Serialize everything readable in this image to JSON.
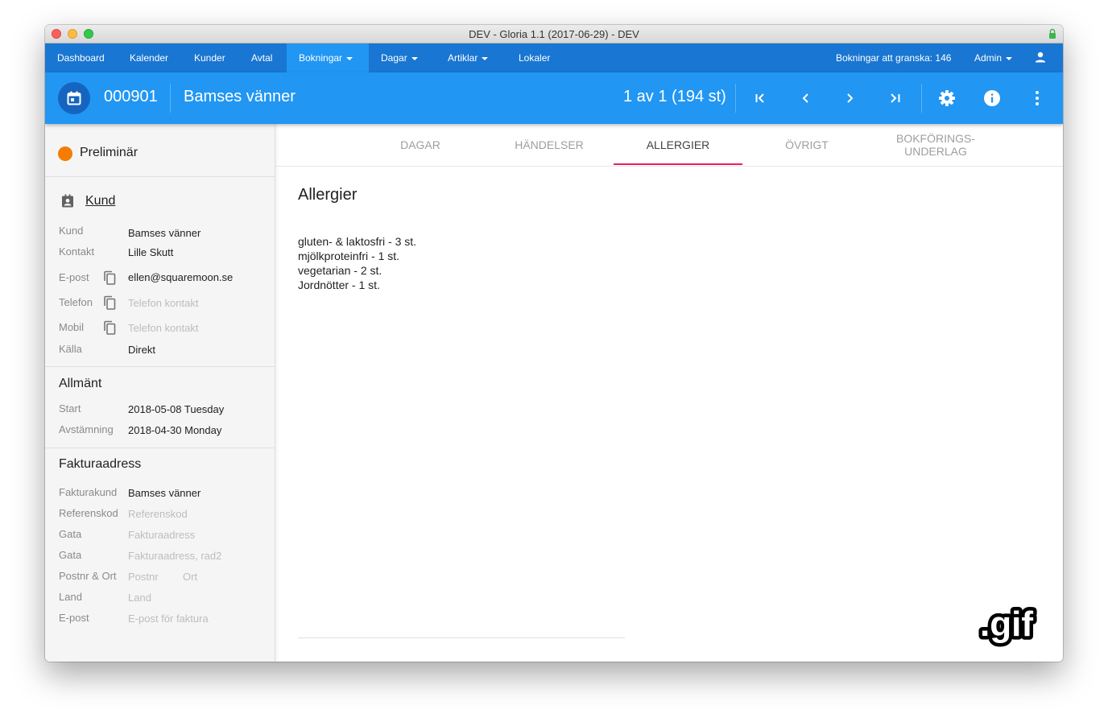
{
  "window": {
    "title": "DEV - Gloria 1.1 (2017-06-29) - DEV"
  },
  "nav": {
    "items": [
      {
        "label": "Dashboard"
      },
      {
        "label": "Kalender"
      },
      {
        "label": "Kunder"
      },
      {
        "label": "Avtal"
      },
      {
        "label": "Bokningar",
        "dropdown": true,
        "active": true
      },
      {
        "label": "Dagar",
        "dropdown": true
      },
      {
        "label": "Artiklar",
        "dropdown": true
      },
      {
        "label": "Lokaler"
      }
    ],
    "review": "Bokningar att granska: 146",
    "admin": "Admin"
  },
  "appbar": {
    "booking_number": "000901",
    "booking_name": "Bamses vänner",
    "counter": "1 av 1 (194 st)"
  },
  "sidebar": {
    "status": {
      "label": "Preliminär",
      "color": "#f57c00"
    },
    "customer_section": "Kund",
    "customer": [
      {
        "label": "Kund",
        "value": "Bamses vänner"
      },
      {
        "label": "Kontakt",
        "value": "Lille Skutt"
      },
      {
        "label": "E-post",
        "value": "ellen@squaremoon.se"
      },
      {
        "label": "Telefon",
        "value": "Telefon kontakt"
      },
      {
        "label": "Mobil",
        "value": "Telefon kontakt"
      },
      {
        "label": "Källa",
        "value": "Direkt"
      }
    ],
    "general_section": "Allmänt",
    "general": [
      {
        "label": "Start",
        "value": "2018-05-08 Tuesday"
      },
      {
        "label": "Avstämning",
        "value": "2018-04-30 Monday"
      }
    ],
    "invoice_section": "Fakturaadress",
    "invoice": [
      {
        "label": "Fakturakund",
        "value": "Bamses vänner"
      },
      {
        "label": "Referenskod",
        "value": "Referenskod"
      },
      {
        "label": "Gata",
        "value": "Fakturaadress"
      },
      {
        "label": "Gata",
        "value": "Fakturaadress, rad2"
      },
      {
        "label": "Postnr & Ort",
        "value": "Postnr",
        "value2": "Ort"
      },
      {
        "label": "Land",
        "value": "Land"
      },
      {
        "label": "E-post",
        "value": "E-post för faktura"
      }
    ]
  },
  "tabs": [
    {
      "label": "DAGAR"
    },
    {
      "label": "HÄNDELSER"
    },
    {
      "label": "ALLERGIER",
      "active": true
    },
    {
      "label": "ÖVRIGT"
    },
    {
      "label_line1": "BOKFÖRINGS-",
      "label_line2": "UNDERLAG"
    }
  ],
  "content": {
    "title": "Allergier",
    "items": [
      "gluten- & laktosfri - 3 st.",
      "mjölkproteinfri - 1 st.",
      "vegetarian - 2 st.",
      "Jordnötter - 1 st."
    ]
  },
  "badge": ".gif",
  "colors": {
    "nav_bg": "#1976d2",
    "appbar_bg": "#2196f3",
    "active_nav": "#2196f3",
    "tab_indicator": "#e91e63",
    "status_dot": "#f57c00"
  }
}
